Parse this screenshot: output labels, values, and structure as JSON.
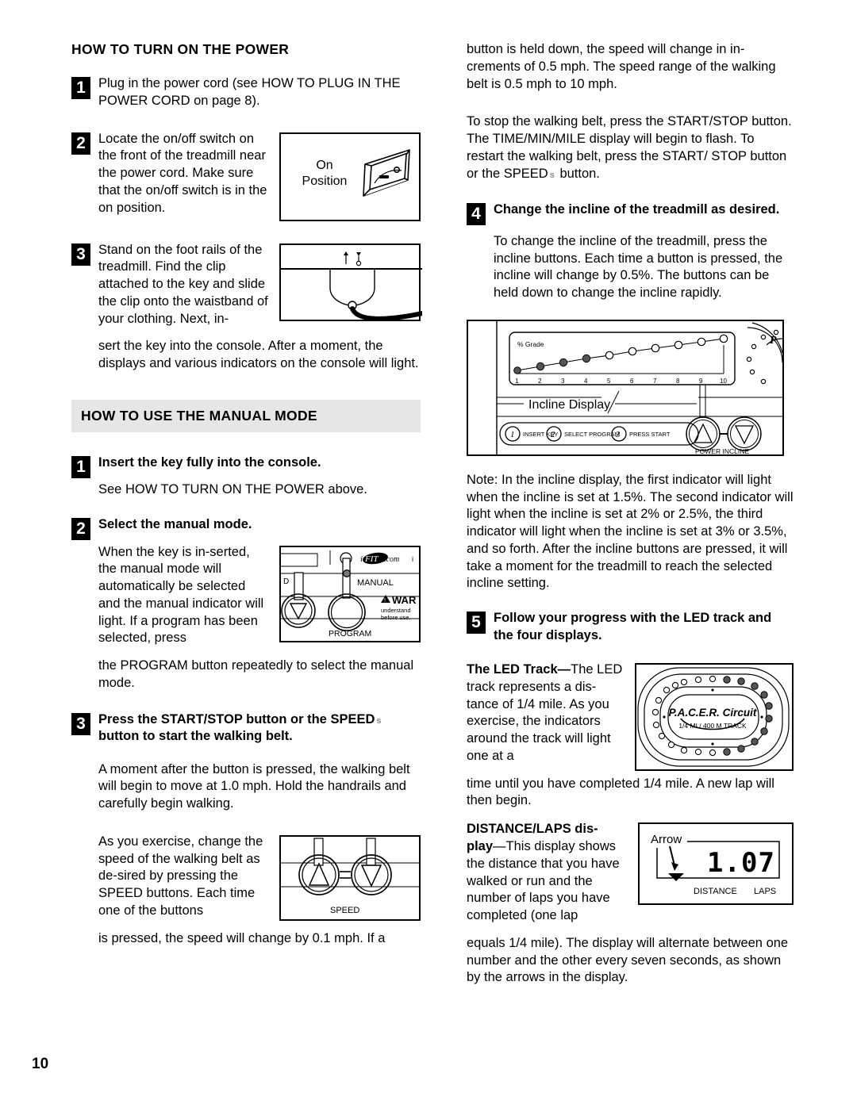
{
  "page": {
    "number": "10"
  },
  "left_column": {
    "heading": "HOW TO TURN ON THE POWER",
    "steps": [
      {
        "num": "1",
        "text": "Plug in the power cord (see HOW TO PLUG IN THE POWER CORD on page 8)."
      },
      {
        "num": "2",
        "text_wrap": "Locate the on/off switch on the front of the treadmill near the power cord. Make sure that the on/off switch is in the on position."
      },
      {
        "num": "3",
        "text_wrap": "Stand on the foot rails of the treadmill. Find the clip attached to the key and slide the clip onto the waistband of your clothing. Next, in-",
        "text_rest": "sert the key into the console. After a moment, the displays and various indicators on the console will light."
      }
    ],
    "figures": {
      "onoff": {
        "label_line1": "On",
        "label_line2": "Position"
      }
    }
  },
  "manual_section": {
    "heading": "HOW TO USE THE MANUAL MODE",
    "steps": [
      {
        "num": "1",
        "title": "Insert the key fully into the console.",
        "body": "See HOW TO TURN ON THE POWER above."
      },
      {
        "num": "2",
        "title": "Select the manual mode.",
        "body_wrap": "When the key is in-serted, the manual mode will automatically be selected and the manual indicator will light. If a program has been selected, press",
        "body_rest": "the PROGRAM button repeatedly to select the manual mode."
      },
      {
        "num": "3",
        "title_part1": "Press the START/STOP button or the SPEED",
        "title_glyph": "s",
        "title_part2": "button to start the walking belt.",
        "body1": "A moment after the button is pressed, the walking belt will begin to move at 1.0 mph. Hold the handrails and carefully begin walking.",
        "body_wrap": "As you exercise, change the speed of the walking belt as de-sired by pressing the SPEED buttons. Each time one of the buttons",
        "body_rest": "is pressed, the speed will change by 0.1 mph. If a"
      }
    ],
    "figures": {
      "console": {
        "logo": "iFIT.com",
        "manual_label": "MANUAL",
        "program_label": "PROGRAM",
        "warning_label": "WAR",
        "warning_line1": "understand",
        "warning_line2": "before use.",
        "left_letter": "D",
        "right_letter": "i"
      },
      "speed": {
        "label": "SPEED"
      }
    }
  },
  "right_column": {
    "continuation": {
      "para1": "button is held down, the speed will change in in-crements of 0.5 mph. The speed range of the walking belt is 0.5 mph to 10 mph.",
      "para2_part1": "To stop the walking belt, press the START/STOP button. The TIME/MIN/MILE display will begin to flash. To restart the walking belt, press the START/ STOP button or the SPEED",
      "para2_glyph": "s",
      "para2_part2": "button."
    },
    "steps": [
      {
        "num": "4",
        "title": "Change the incline of the treadmill as desired.",
        "body": "To change the incline of the treadmill, press the incline buttons. Each time a button is pressed, the incline will change by 0.5%. The buttons can be held down to change the incline rapidly."
      },
      {
        "num": "5",
        "title": "Follow your progress with the LED track and the four displays."
      }
    ],
    "note": "Note: In the incline display, the first indicator will light when the incline is set at 1.5%. The second indicator will light when the incline is set at 2% or 2.5%, the third indicator will light when the incline is set at 3% or 3.5%, and so forth. After the incline buttons are pressed, it will take a moment for the treadmill to reach the selected incline setting.",
    "led_track": {
      "title": "The LED Track—",
      "body_wrap": "The LED track represents a dis-tance of 1/4 mile. As you exercise, the indicators around the track will light one at a",
      "body_rest": "time until you have completed 1/4 mile. A new lap will then begin."
    },
    "distance_laps": {
      "title_line1": "DISTANCE/LAPS dis-",
      "title_line2": "play",
      "body_wrap": "—This display shows the distance that you have walked or run and the number of laps you have completed (one lap",
      "body_rest": "equals 1/4 mile). The display will alternate between one number and the other every seven seconds, as shown by the arrows in the display."
    },
    "figures": {
      "incline": {
        "grade_label": "% Grade",
        "ticks": [
          "1",
          "2",
          "3",
          "4",
          "5",
          "6",
          "7",
          "8",
          "9",
          "10"
        ],
        "lit": [
          true,
          true,
          true,
          true,
          false,
          false,
          false,
          false,
          false,
          false
        ],
        "caption": "Incline Display",
        "steps_strip": [
          {
            "num": "1",
            "label": "INSERT KEY"
          },
          {
            "num": "2",
            "label": "SELECT PROGRAM"
          },
          {
            "num": "3",
            "label": "PRESS START"
          }
        ],
        "power_incline_label": "POWER INCLINE"
      },
      "pacer": {
        "brand": "P.A.C.E.R. Circuit",
        "subtitle": "1/4 MI / 400 M TRACK"
      },
      "distance_display": {
        "arrow_label": "Arrow",
        "value": "1.07",
        "label_left": "DISTANCE",
        "label_right": "LAPS"
      }
    }
  },
  "chart_data": {
    "type": "bar",
    "title": "Incline Display % Grade indicators",
    "categories": [
      "1",
      "2",
      "3",
      "4",
      "5",
      "6",
      "7",
      "8",
      "9",
      "10"
    ],
    "values": [
      1,
      1,
      1,
      1,
      0,
      0,
      0,
      0,
      0,
      0
    ],
    "xlabel": "% Grade",
    "ylabel": "",
    "ylim": [
      0,
      1
    ]
  }
}
